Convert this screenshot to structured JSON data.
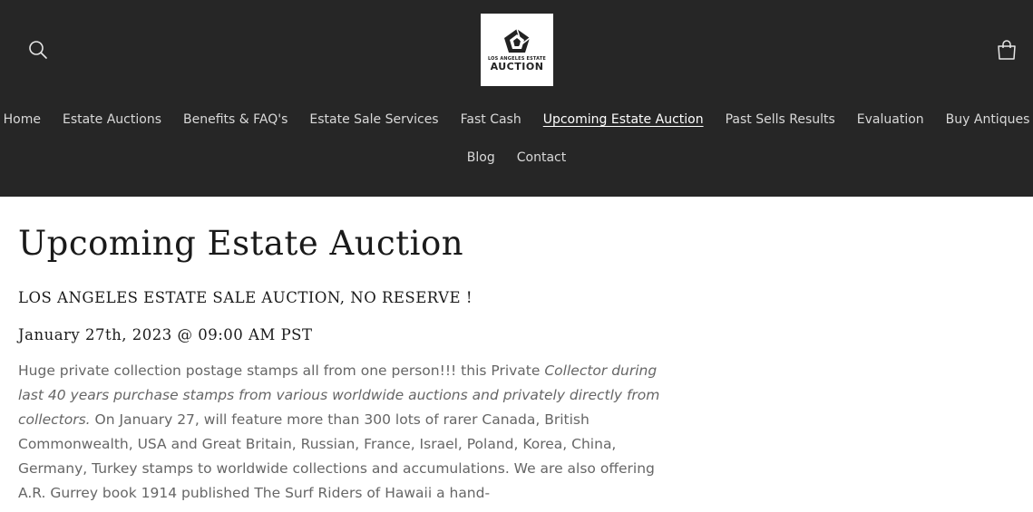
{
  "header": {
    "logo": {
      "line1": "LOS ANGELES ESTATE",
      "line2": "AUCTION"
    },
    "icons": {
      "search": "search-icon",
      "cart": "cart-icon"
    }
  },
  "nav": {
    "row1": [
      {
        "label": "Home"
      },
      {
        "label": "Estate Auctions"
      },
      {
        "label": "Benefits & FAQ's"
      },
      {
        "label": "Estate Sale Services"
      },
      {
        "label": "Fast Cash"
      },
      {
        "label": "Upcoming Estate Auction",
        "active": true
      },
      {
        "label": "Past Sells Results"
      },
      {
        "label": "Evaluation"
      },
      {
        "label": "Buy Antiques"
      }
    ],
    "row2": [
      {
        "label": "Blog"
      },
      {
        "label": "Contact"
      }
    ]
  },
  "main": {
    "title": "Upcoming Estate Auction",
    "subhead1": "LOS ANGELES ESTATE SALE AUCTION, NO RESERVE !",
    "subhead2": "January 27th, 2023 @ 09:00 AM PST",
    "body": {
      "part1": "Huge private collection postage stamps all from one person!!!  this Private ",
      "part2_italic": "Collector during last 40 years purchase stamps from various worldwide auctions  and privately directly from collectors.",
      "part3": "  On January 27, will feature more than 300 lots of rarer Canada, British Commonwealth, USA and Great Britain, Russian, France, Israel, Poland, Korea, China, Germany, Turkey stamps to worldwide collections and accumulations. We are also offering A.R. Gurrey book 1914 published The Surf Riders of Hawaii a hand-"
    }
  },
  "colors": {
    "header_bg": "#262626",
    "nav_text": "#d9d9d9",
    "body_text": "#666666",
    "heading_text": "#1a1a1a"
  }
}
